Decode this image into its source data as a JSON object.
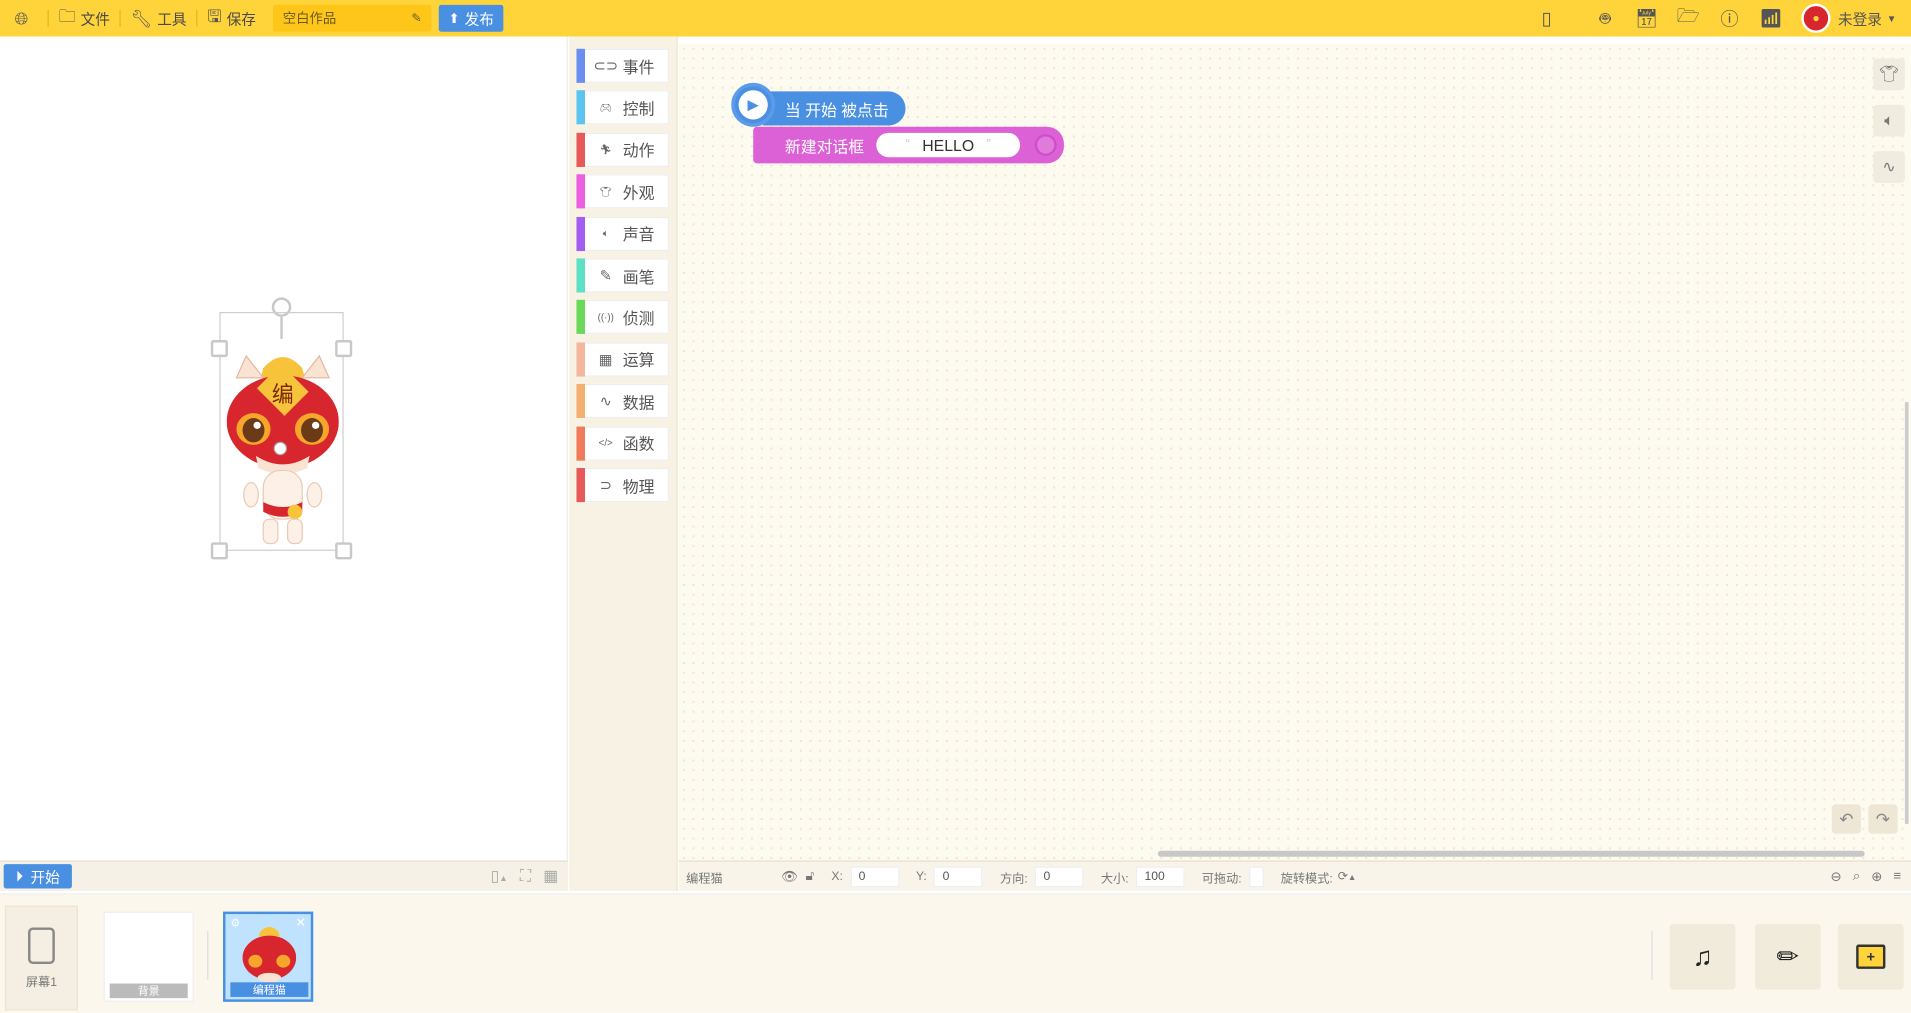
{
  "topbar": {
    "file_label": "文件",
    "tools_label": "工具",
    "save_label": "保存",
    "title_value": "空白作品",
    "publish_label": "发布",
    "login_label": "未登录"
  },
  "categories": [
    {
      "label": "事件",
      "color": "#6b8ff0",
      "icon": "toggle-icon"
    },
    {
      "label": "控制",
      "color": "#5bc4f0",
      "icon": "gamepad-icon"
    },
    {
      "label": "动作",
      "color": "#e85a5a",
      "icon": "running-icon"
    },
    {
      "label": "外观",
      "color": "#ee5ee0",
      "icon": "shirt-icon"
    },
    {
      "label": "声音",
      "color": "#a25ef0",
      "icon": "speaker-icon"
    },
    {
      "label": "画笔",
      "color": "#5ee0c4",
      "icon": "pen-icon"
    },
    {
      "label": "侦测",
      "color": "#6ad858",
      "icon": "sensor-icon"
    },
    {
      "label": "运算",
      "color": "#f4b69c",
      "icon": "calculator-icon"
    },
    {
      "label": "数据",
      "color": "#f3b070",
      "icon": "data-icon"
    },
    {
      "label": "函数",
      "color": "#f07a5a",
      "icon": "code-icon"
    },
    {
      "label": "物理",
      "color": "#e85a5a",
      "icon": "magnet-icon"
    }
  ],
  "blocks": {
    "hat_label": "当 开始 被点击",
    "dialog_label": "新建对话框",
    "dialog_value": "HELLO"
  },
  "stage": {
    "start_label": "开始"
  },
  "props": {
    "sprite_name": "编程猫",
    "x_label": "X:",
    "x_value": "0",
    "y_label": "Y:",
    "y_value": "0",
    "dir_label": "方向:",
    "dir_value": "0",
    "size_label": "大小:",
    "size_value": "100",
    "drag_label": "可拖动:",
    "rot_label": "旋转模式:"
  },
  "bottom": {
    "screen_label": "屏幕1",
    "bg_label": "背景",
    "sprite_label": "编程猫"
  },
  "colors": {
    "topbar": "#ffd43b",
    "accent": "#4a90e2",
    "dialog_block": "#dd61d6"
  }
}
